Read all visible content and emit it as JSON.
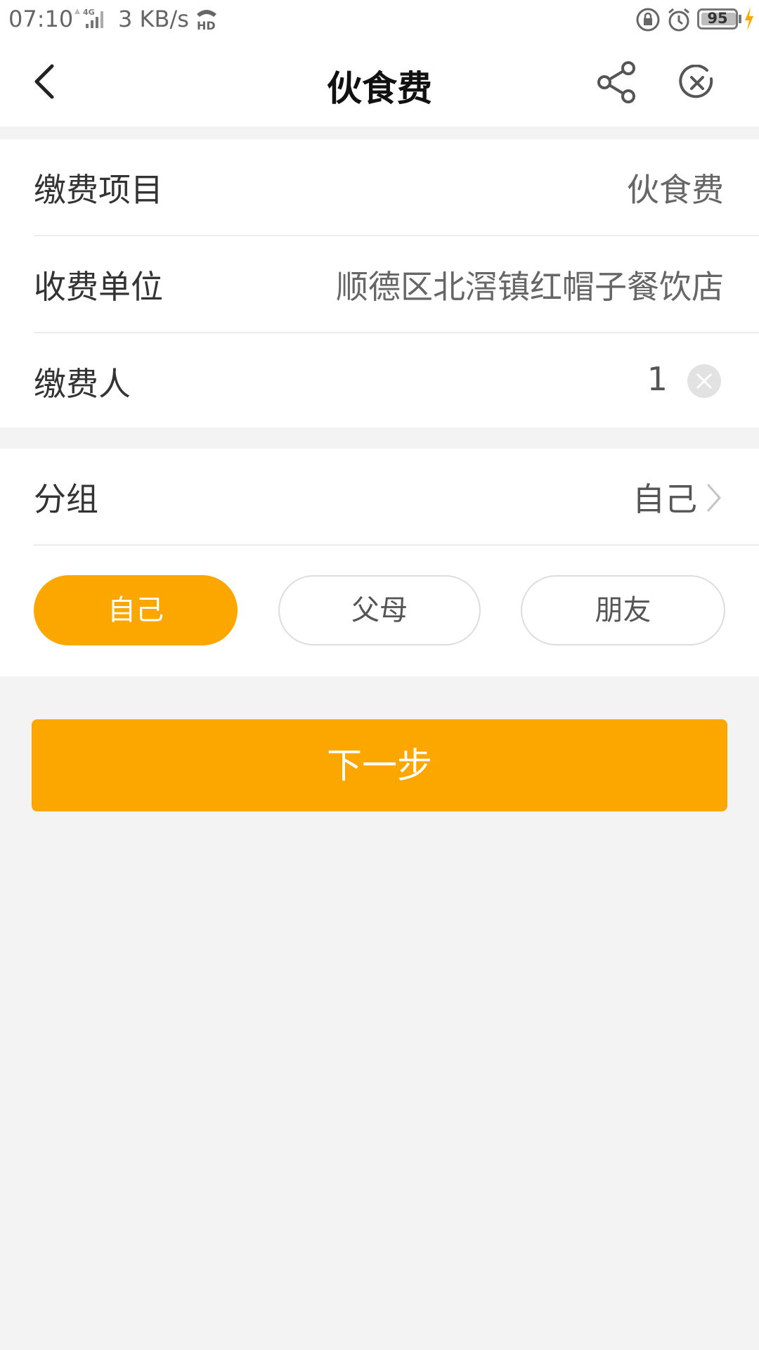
{
  "status_bar": {
    "time": "07:10",
    "network": "4G",
    "speed": "3 KB/s",
    "battery": "95",
    "icons": [
      "signal-icon",
      "hd-call-icon",
      "lock-rotation-icon",
      "alarm-icon",
      "battery-icon",
      "charging-icon"
    ]
  },
  "nav": {
    "title": "伙食费",
    "icons": [
      "back-arrow-icon",
      "share-icon",
      "close-circle-icon"
    ]
  },
  "form": {
    "item_label": "缴费项目",
    "item_value": "伙食费",
    "payee_label": "收费单位",
    "payee_value": "顺德区北滘镇红帽子餐饮店",
    "payer_label": "缴费人",
    "payer_value": "1"
  },
  "group": {
    "label": "分组",
    "value": "自己",
    "options": [
      "自己",
      "父母",
      "朋友"
    ],
    "selected": "自己"
  },
  "next_button": "下一步",
  "colors": {
    "accent": "#fca700",
    "background": "#f3f3f3",
    "card": "#ffffff"
  }
}
